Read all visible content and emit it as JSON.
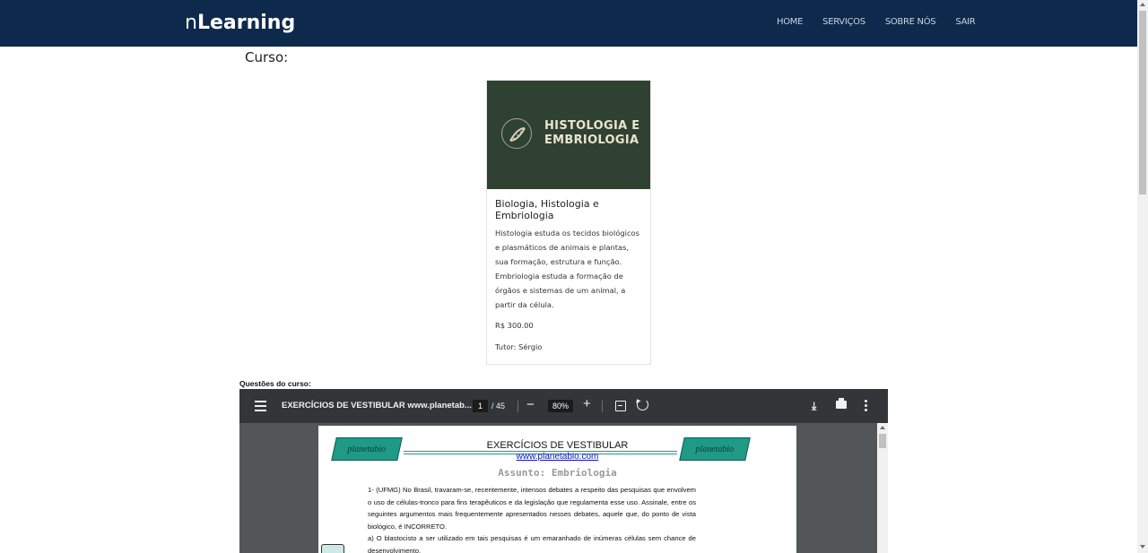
{
  "navbar": {
    "brand_prefix": "n",
    "brand_main": "Learning",
    "links": [
      "HOME",
      "SERVIÇOS",
      "SOBRE NÓS",
      "SAIR"
    ]
  },
  "course_heading": "Curso:",
  "card": {
    "image_title_line1": "HISTOLOGIA E",
    "image_title_line2": "EMBRIOLOGIA",
    "title": "Biologia, Histologia e Embriologia",
    "description": "Histologia estuda os tecidos biológicos e plasmáticos de animais e plantas, sua formação, estrutura e função. Embriologia estuda a formação de órgãos e sistemas de um animal, a partir da célula.",
    "price": "R$ 300.00",
    "tutor": "Tutor: Sérgio"
  },
  "questions_label": "Questões do curso:",
  "pdf": {
    "title": "EXERCÍCIOS DE VESTIBULAR www.planetab...",
    "current_page": "1",
    "total_pages": "/ 45",
    "zoom": "80%",
    "page": {
      "logo_text": "planetabio",
      "doc_title": "EXERCÍCIOS DE VESTIBULAR",
      "doc_url": "www.planetabio.com",
      "subject": "Assunto: Embriologia",
      "paragraphs": [
        "1- (UFMG) No Brasil, travaram-se, recentemente, intensos debates a respeito das pesquisas que envolvem o uso de células-tronco para fins terapêuticos e da legislação que regulamenta esse uso. Assinale, entre os seguintes argumentos mais frequentemente apresentados nesses debates, aquele que, do ponto de vista biológico, é INCORRETO.",
        "a) O blastocisto a ser utilizado em tais pesquisas é um emaranhado de inúmeras células sem chance de desenvolvimento."
      ]
    }
  },
  "colors": {
    "navbar_bg": "#0d2a4d",
    "card_image_bg": "#2f4132",
    "pdf_toolbar_bg": "#323639",
    "pdf_bg": "#525659"
  }
}
